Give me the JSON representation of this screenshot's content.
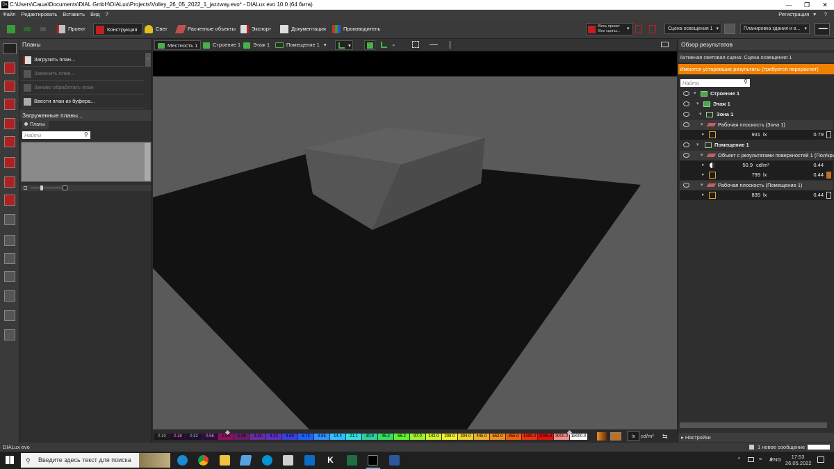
{
  "window": {
    "title": "C:\\Users\\Саша\\Documents\\DIAL GmbH\\DIALux\\Projects\\Volley_26_05_2022_1_jazzway.evo* - DIALux evo 10.0  (64 бита)",
    "app_icon": "Dx"
  },
  "menu": {
    "items": [
      "Файл",
      "Редактировать",
      "Вставить",
      "Вид",
      "?"
    ],
    "registration": "Регистрация"
  },
  "ribbon": {
    "tabs": [
      "Проект",
      "Конструкция",
      "Свет",
      "Расчетные объекты",
      "Экспорт",
      "Документация",
      "Производитель"
    ],
    "active_tab": "Конструкция",
    "calc_label1": "Весь проект",
    "calc_label2": "Все сцены...",
    "scene_select": "Сцена освещения 1",
    "layout_select": "Планировка здания и в..."
  },
  "left_panel": {
    "title": "Планы",
    "actions": [
      "Загрузить план...",
      "Заменить план...",
      "Заново обработать план",
      "Ввести план из буфера..."
    ],
    "loaded_title": "Загруженные планы...",
    "tab": "Планы",
    "search_placeholder": "Найти"
  },
  "viewport_toolbar": {
    "tabs": [
      "Местность 1",
      "Строение 1",
      "Этаж 1",
      "Помещение 1"
    ]
  },
  "scale": {
    "values": [
      "0.10",
      "0.18",
      "0.32",
      "0.56",
      "1.00",
      "1.46",
      "2.14",
      "3.13",
      "4.59",
      "6.72",
      "9.85",
      "14.4",
      "21.1",
      "30.9",
      "45.2",
      "66.2",
      "97.0",
      "142.0",
      "208.0",
      "304.0",
      "445.0",
      "652.0",
      "955.0",
      "1399.0",
      "2048.0",
      "3000.0",
      "18000.0"
    ],
    "colors": [
      "#1a1a1a",
      "#2a0a2a",
      "#1a1030",
      "#300a40",
      "#8a1060",
      "#6a1a6a",
      "#6a2aa0",
      "#5a30c0",
      "#3a40e0",
      "#2060ff",
      "#3090ff",
      "#30c0ff",
      "#30e0e0",
      "#30d0a0",
      "#30e060",
      "#60f030",
      "#a0f030",
      "#d0f030",
      "#f0f030",
      "#f0d030",
      "#f0b030",
      "#f09020",
      "#f06010",
      "#f03010",
      "#e01010",
      "#f09090",
      "#ffffff"
    ],
    "unit1": "lx",
    "unit2": "cd/m²"
  },
  "right_panel": {
    "title": "Обзор результатов",
    "active_scene": "Активная световая сцена: Сцена освещения 1",
    "warning": "Имеются устаревшие результаты (требуется перерасчет)",
    "search_placeholder": "Найти",
    "tree": {
      "building": "Строение 1",
      "floor": "Этаж 1",
      "zone": "Зона 1",
      "work_plane_zone": "Рабочая плоскость (Зона 1)",
      "wp_zone_value": "931",
      "wp_zone_unit": "lx",
      "wp_zone_ratio": "0.79",
      "room": "Помещение 1",
      "surface_obj": "Объект с результатами поверхностей 1 (Пол/крыша",
      "lum_value": "50.9",
      "lum_unit": "cd/m²",
      "lum_ratio": "0.44",
      "ill_value": "799",
      "ill_unit": "lx",
      "ill_ratio": "0.44",
      "work_plane_room": "Рабочая плоскость (Помещение 1)",
      "wp_room_value": "835",
      "wp_room_unit": "lx",
      "wp_room_ratio": "0.44"
    },
    "settings": "Настройки"
  },
  "status": {
    "left": "DIALux evo",
    "messages": "1 новое сообщение"
  },
  "taskbar": {
    "search_placeholder": "Введите здесь текст для поиска",
    "lang": "ENG",
    "time": "17:53",
    "date": "26.05.2022"
  }
}
